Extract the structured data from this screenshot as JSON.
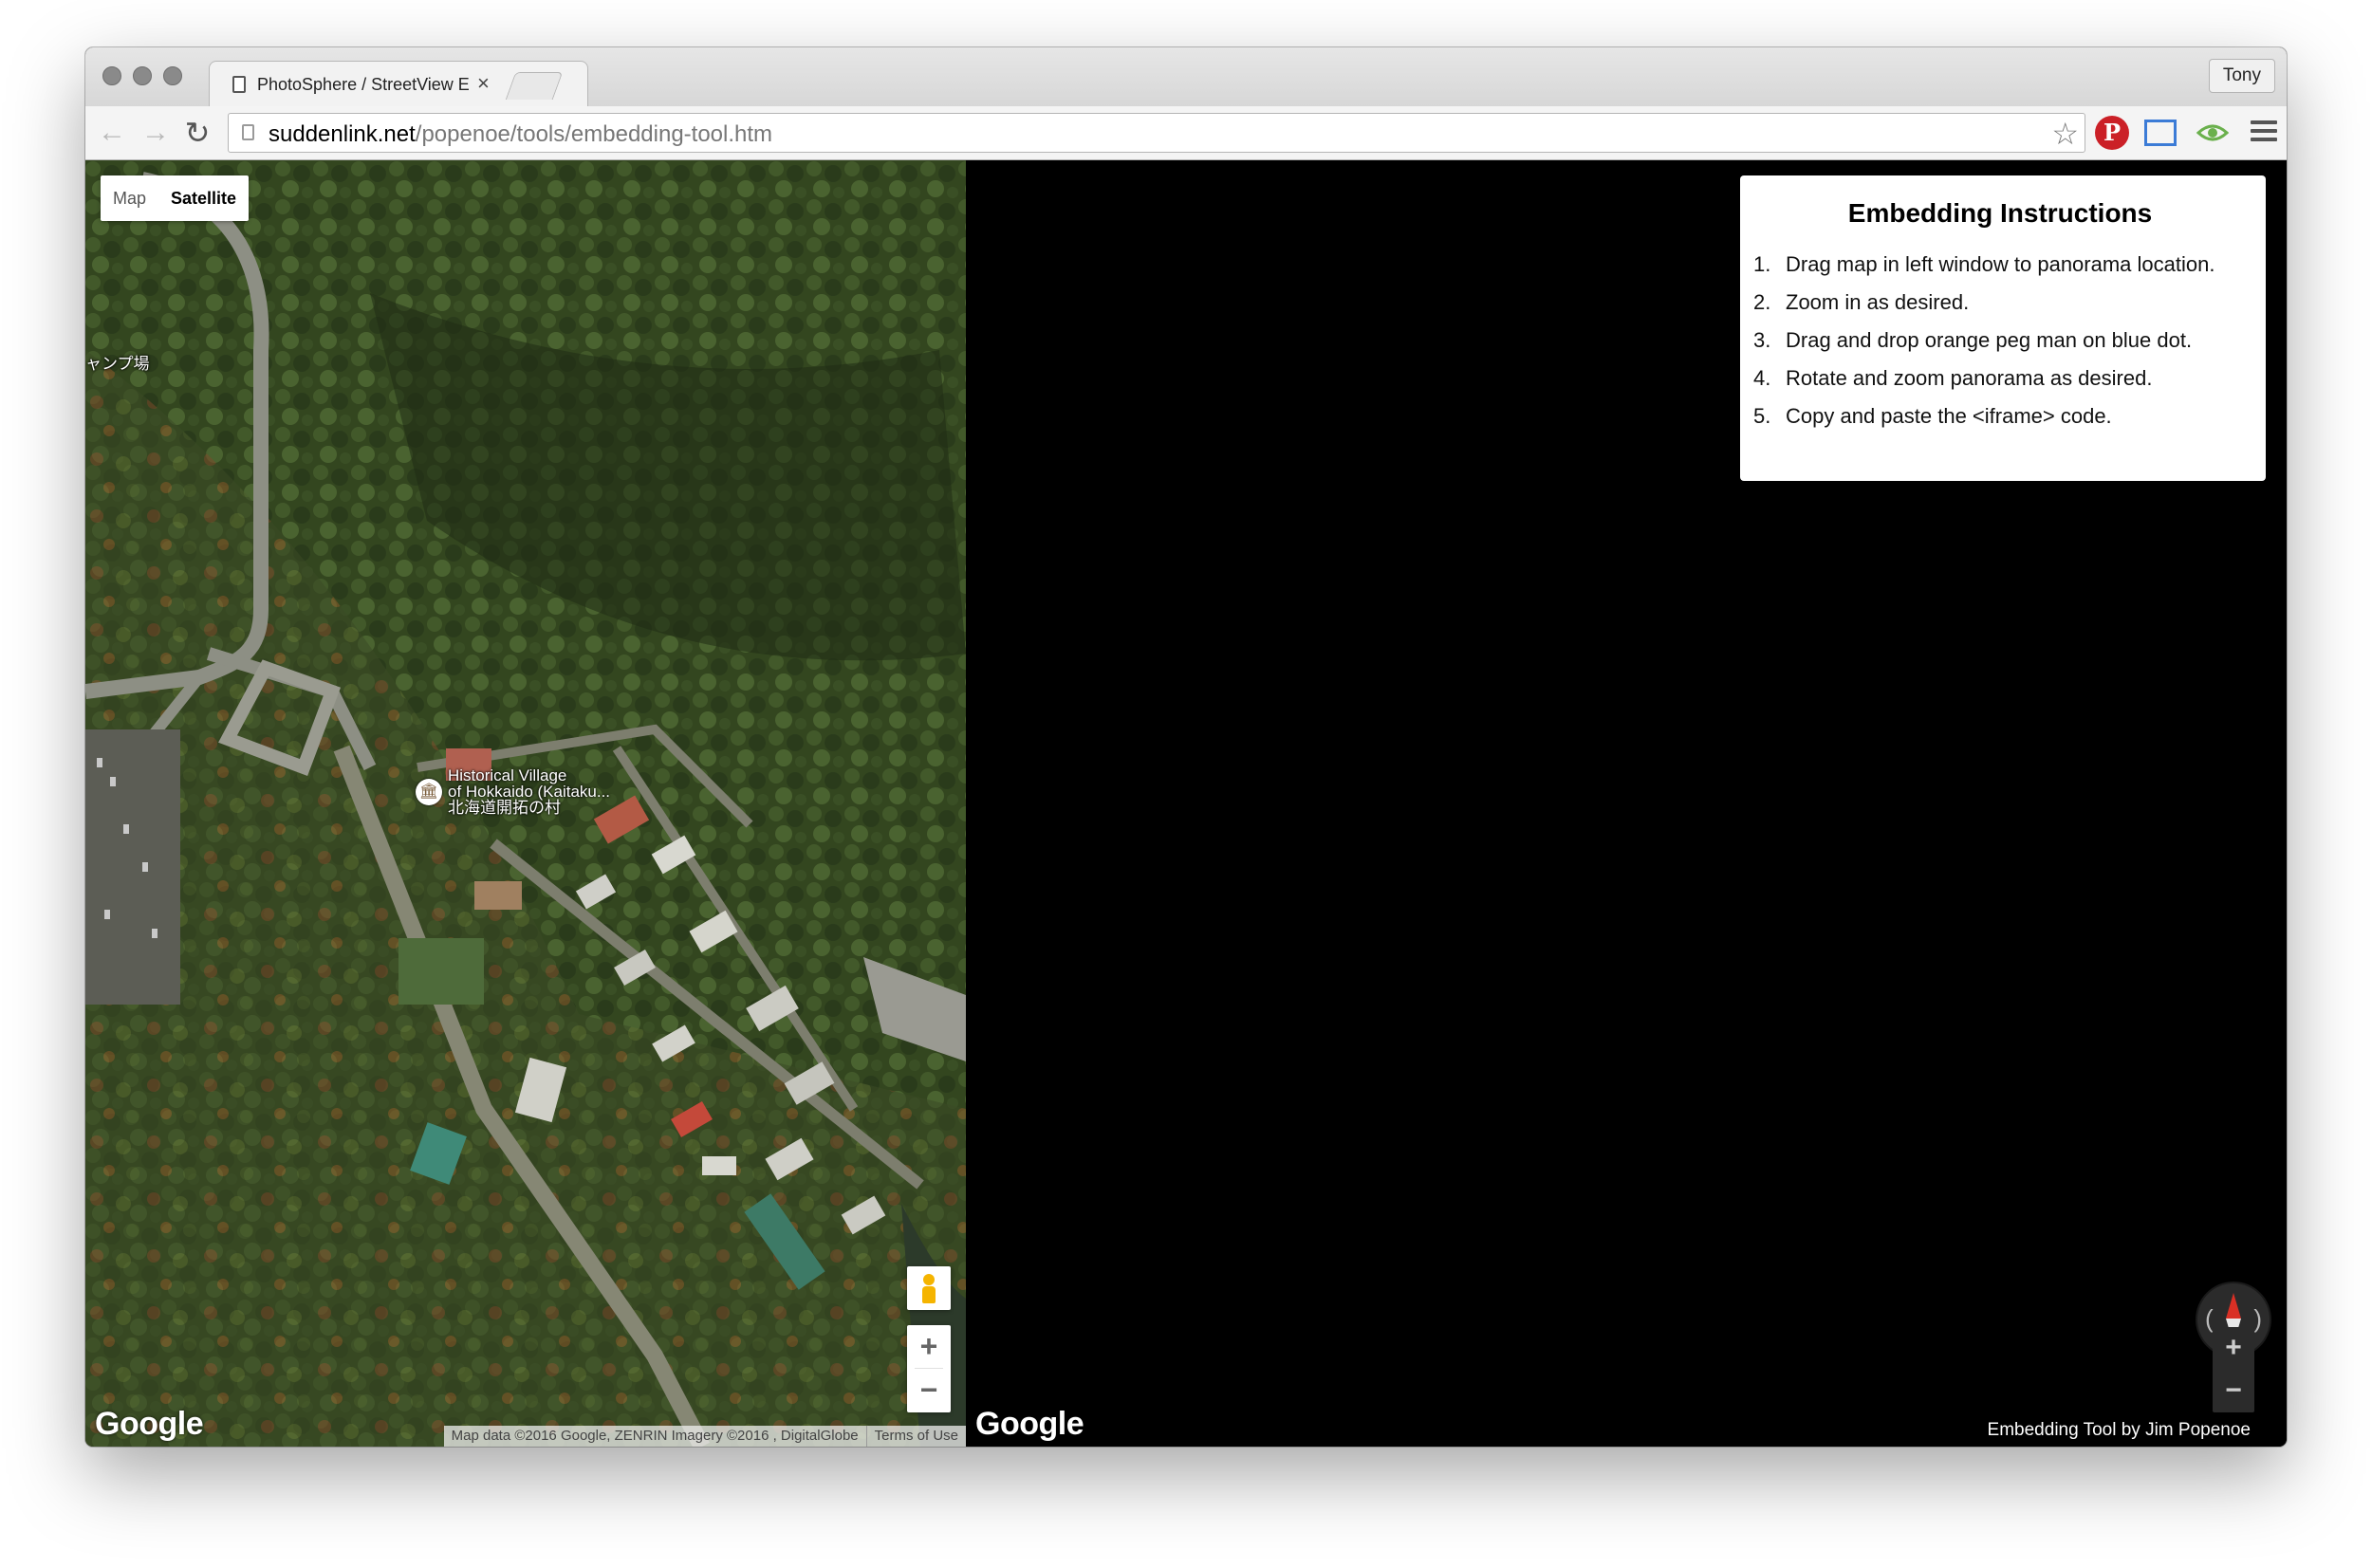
{
  "browser": {
    "tab_title": "PhotoSphere / StreetView E",
    "tab_close_icon": "close-icon",
    "user_label": "Tony",
    "url_host": "suddenlink.net",
    "url_path": "/popenoe/tools/embedding-tool.htm",
    "pinterest_glyph": "P"
  },
  "map": {
    "map_type_options": [
      "Map",
      "Satellite"
    ],
    "selected_map_type": "Satellite",
    "partial_label": "ャンプ場",
    "poi_name_lines": [
      "Historical Village",
      "of Hokkaido (Kaitaku...",
      "北海道開拓の村"
    ],
    "google_logo": "Google",
    "attribution": "Map data ©2016 Google, ZENRIN Imagery ©2016 , DigitalGlobe",
    "terms": "Terms of Use",
    "zoom_in": "+",
    "zoom_out": "−"
  },
  "panorama": {
    "google_logo": "Google",
    "instructions_title": "Embedding Instructions",
    "steps": [
      "Drag map in left window to panorama location.",
      "Zoom in as desired.",
      "Drag and drop orange peg man on blue dot.",
      "Rotate and zoom panorama as desired.",
      "Copy and paste the <iframe> code."
    ],
    "credit": "Embedding Tool by Jim Popenoe",
    "zoom_in": "+",
    "zoom_out": "−"
  }
}
